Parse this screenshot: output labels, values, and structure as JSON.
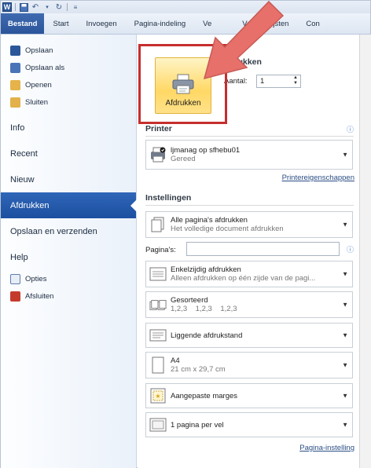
{
  "title_bar": {
    "app_icon_label": "W",
    "icons": [
      "save-icon",
      "undo-icon",
      "redo-icon",
      "customize-icon"
    ]
  },
  "ribbon_tabs": [
    "Bestand",
    "Start",
    "Invoegen",
    "Pagina-indeling",
    "Ve",
    "Verzendlijsten",
    "Con"
  ],
  "nav": {
    "commands": [
      {
        "label": "Opslaan",
        "icon": "save-icon",
        "color": "#2b579a"
      },
      {
        "label": "Opslaan als",
        "icon": "save-as-icon",
        "color": "#4a74b8"
      },
      {
        "label": "Openen",
        "icon": "open-folder-icon",
        "color": "#e5b34a"
      },
      {
        "label": "Sluiten",
        "icon": "close-folder-icon",
        "color": "#e2b14a"
      }
    ],
    "sections": [
      "Info",
      "Recent",
      "Nieuw",
      "Afdrukken",
      "Opslaan en verzenden",
      "Help"
    ],
    "selected": "Afdrukken",
    "footer_commands": [
      {
        "label": "Opties",
        "icon": "options-icon",
        "color": "#5d7fb2"
      },
      {
        "label": "Afsluiten",
        "icon": "exit-icon",
        "color": "#c53b2b"
      }
    ]
  },
  "print": {
    "heading": "Afdrukken",
    "button_label": "Afdrukken",
    "copies_label": "Aantal:",
    "copies_value": "1"
  },
  "printer": {
    "heading": "Printer",
    "name": "ljmanag op sfhebu01",
    "status": "Gereed",
    "properties_link": "Printereigenschappen"
  },
  "settings": {
    "heading": "Instellingen",
    "pages_label": "Pagina's:",
    "pages_value": "",
    "dropdowns": [
      {
        "title": "Alle pagina's afdrukken",
        "subtitle": "Het volledige document afdrukken",
        "icon": "pages-icon"
      },
      {
        "title": "Enkelzijdig afdrukken",
        "subtitle": "Alleen afdrukken op één zijde van de pagi...",
        "icon": "single-sided-icon"
      },
      {
        "title": "Gesorteerd",
        "subtitle": "1,2,3    1,2,3    1,2,3",
        "icon": "collated-icon"
      },
      {
        "title": "Liggende afdrukstand",
        "subtitle": "",
        "icon": "landscape-icon"
      },
      {
        "title": "A4",
        "subtitle": "21 cm x 29,7 cm",
        "icon": "paper-size-icon"
      },
      {
        "title": "Aangepaste marges",
        "subtitle": "",
        "icon": "margins-icon"
      },
      {
        "title": "1 pagina per vel",
        "subtitle": "",
        "icon": "pages-per-sheet-icon"
      }
    ],
    "page_setup_link": "Pagina-instelling"
  },
  "annotation": {
    "highlight_color": "#c62e2e",
    "arrow_color": "#e8706a"
  }
}
